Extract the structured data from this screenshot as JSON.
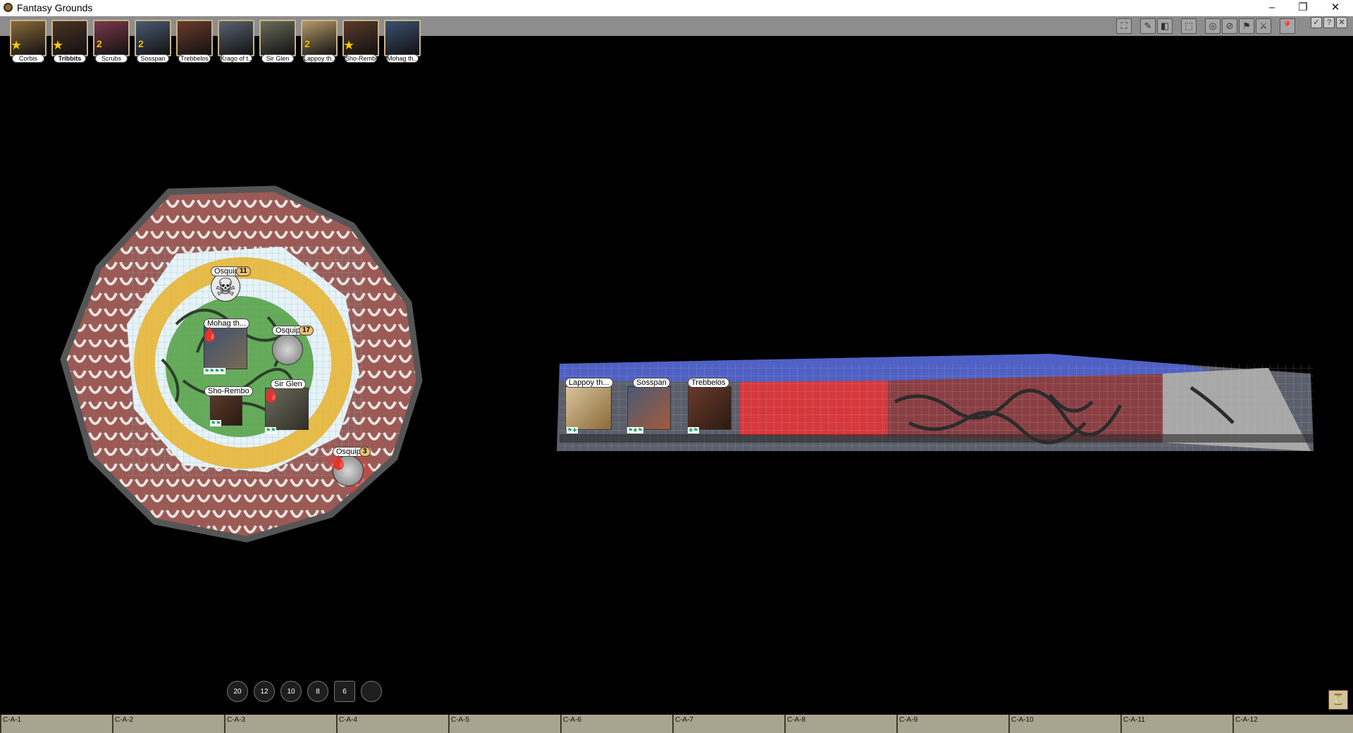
{
  "window": {
    "title": "Fantasy Grounds",
    "minimize": "–",
    "restore": "❐",
    "close": "✕"
  },
  "party": [
    {
      "name": "Corbis",
      "marker": "star",
      "marker_text": "★",
      "color": "#8a6a3c"
    },
    {
      "name": "Tribbits",
      "marker": "star",
      "marker_text": "★",
      "active": true,
      "color": "#4a3326"
    },
    {
      "name": "Scrubs",
      "marker": "number",
      "marker_text": "2",
      "color": "#7a3a4a"
    },
    {
      "name": "Sosspan",
      "marker": "number",
      "marker_text": "2",
      "color": "#4a5a74"
    },
    {
      "name": "Trebbelos",
      "marker": "",
      "marker_text": "",
      "color": "#6b3a2a"
    },
    {
      "name": "Krago of t...",
      "marker": "",
      "marker_text": "",
      "color": "#5a6270"
    },
    {
      "name": "Sir Glen",
      "marker": "",
      "marker_text": "",
      "color": "#6a6a5a"
    },
    {
      "name": "Lappoy th...",
      "marker": "number",
      "marker_text": "2",
      "color": "#b59a6a"
    },
    {
      "name": "Sho-Rembo",
      "marker": "star",
      "marker_text": "★",
      "color": "#5a3a2a"
    },
    {
      "name": "Mohag th...",
      "marker": "",
      "marker_text": "",
      "color": "#3c5070"
    }
  ],
  "toolbar": {
    "icons": [
      "fullscreen-icon",
      "pencil-icon",
      "eraser-icon",
      "select-icon",
      "target-icon",
      "mask-icon",
      "flag-icon",
      "crossed-swords-icon",
      "pin-icon",
      "lock-icon",
      "help-icon",
      "close-icon"
    ],
    "glyphs": [
      "⛶",
      "✎",
      "◧",
      "⬚",
      "◎",
      "⊘",
      "⚑",
      "⚔",
      "📍",
      "✓",
      "?",
      "✕"
    ]
  },
  "map_round": {
    "tokens": [
      {
        "name": "Osquip",
        "badge": "11",
        "state": "dead",
        "glyph": "☠"
      },
      {
        "name": "Mohag th...",
        "effects": "⚑⚑⚑⚑",
        "state": "bloodied",
        "glyph": "🩸"
      },
      {
        "name": "Osquip",
        "badge": "17",
        "state": "healthy"
      },
      {
        "name": "Sho-Rembo",
        "effects": "⚑⚑",
        "state": "healthy"
      },
      {
        "name": "Sir Glen",
        "effects": "⚑⚑",
        "state": "wounded",
        "glyph": "🩸"
      },
      {
        "name": "Osquip",
        "badge": "3",
        "state": "bloodied",
        "glyph": "🩸"
      }
    ]
  },
  "map_corridor": {
    "tokens": [
      {
        "name": "Lappoy th...",
        "effects": "⚑✚"
      },
      {
        "name": "Sosspan",
        "effects": "⚑✚⚑"
      },
      {
        "name": "Trebbelos",
        "effects": "✚⚑"
      }
    ]
  },
  "dice": [
    {
      "label": "20",
      "name": "d20-die"
    },
    {
      "label": "12",
      "name": "d12-die"
    },
    {
      "label": "10",
      "name": "d10-die"
    },
    {
      "label": "8",
      "name": "d8-die"
    },
    {
      "label": "6",
      "name": "d6-die"
    },
    {
      "label": "",
      "name": "d4-die"
    }
  ],
  "timer_glyph": "⏳",
  "hotkeys": [
    "C-A-1",
    "C-A-2",
    "C-A-3",
    "C-A-4",
    "C-A-5",
    "C-A-6",
    "C-A-7",
    "C-A-8",
    "C-A-9",
    "C-A-10",
    "C-A-11",
    "C-A-12"
  ]
}
